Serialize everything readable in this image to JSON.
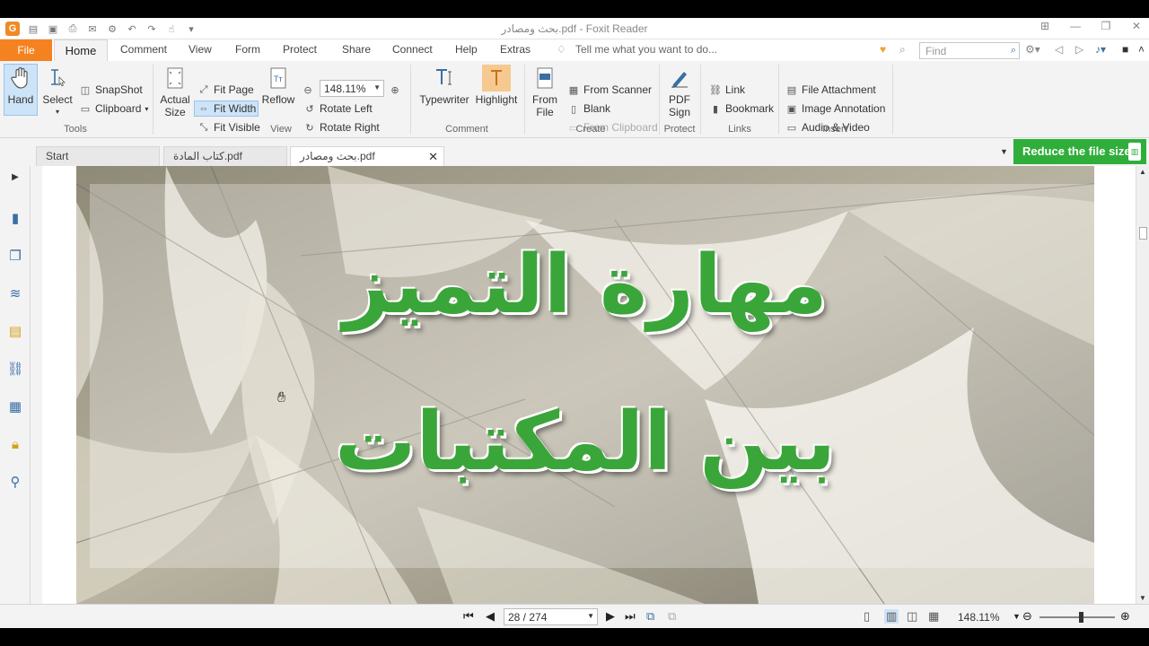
{
  "window": {
    "title": "بحث ومصادر.pdf - Foxit Reader"
  },
  "menu": {
    "file": "File",
    "home": "Home",
    "items": [
      "Comment",
      "View",
      "Form",
      "Protect",
      "Share",
      "Connect",
      "Help",
      "Extras"
    ],
    "tell_me": "Tell me what you want to do...",
    "find_placeholder": "Find"
  },
  "ribbon": {
    "tools": {
      "label": "Tools",
      "hand": "Hand",
      "select": "Select",
      "snapshot": "SnapShot",
      "clipboard": "Clipboard"
    },
    "view": {
      "label": "View",
      "actual_size": [
        "Actual",
        "Size"
      ],
      "fit_page": "Fit Page",
      "fit_width": "Fit Width",
      "fit_visible": "Fit Visible",
      "reflow": "Reflow",
      "zoom": "148.11%",
      "rotate_left": "Rotate Left",
      "rotate_right": "Rotate Right"
    },
    "comment": {
      "label": "Comment",
      "typewriter": "Typewriter",
      "highlight": "Highlight"
    },
    "create": {
      "label": "Create",
      "from_file": [
        "From",
        "File"
      ],
      "from_scanner": "From Scanner",
      "blank": "Blank",
      "from_clipboard": "From Clipboard"
    },
    "protect": {
      "label": "Protect",
      "pdf_sign": [
        "PDF",
        "Sign"
      ]
    },
    "links": {
      "label": "Links",
      "link": "Link",
      "bookmark": "Bookmark"
    },
    "insert": {
      "label": "Insert",
      "file_attachment": "File Attachment",
      "image_annotation": "Image Annotation",
      "audio_video": "Audio & Video"
    }
  },
  "tabs": [
    {
      "label": "Start"
    },
    {
      "label": "كتاب المادة.pdf"
    },
    {
      "label": "بحث ومصادر.pdf"
    }
  ],
  "reduce_banner": "Reduce the file size",
  "page_content": {
    "line1": "مهارة التميز",
    "line2": "بين المكتبات"
  },
  "status": {
    "page": "28 / 274",
    "zoom": "148.11%"
  },
  "colors": {
    "accent": "#f58220",
    "green": "#2fae3a",
    "title_green": "#3aa63a"
  }
}
